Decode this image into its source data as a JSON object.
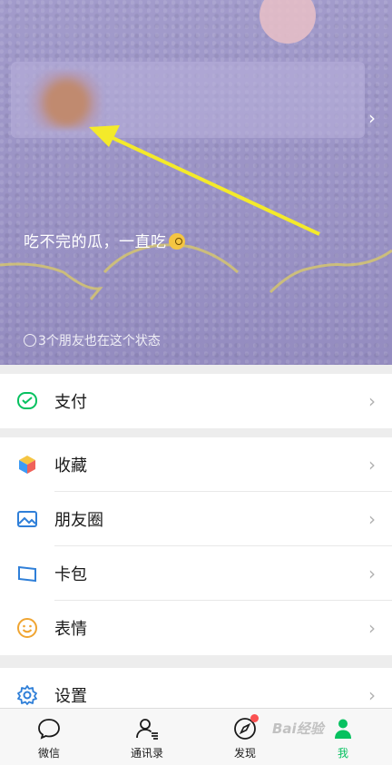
{
  "profile": {
    "status_text": "吃不完的瓜，一直吃",
    "friends_line": "3个朋友也在这个状态"
  },
  "menu": {
    "pay": {
      "label": "支付",
      "icon": "wechat-pay-icon"
    },
    "favorites": {
      "label": "收藏",
      "icon": "cube-icon"
    },
    "moments": {
      "label": "朋友圈",
      "icon": "image-icon"
    },
    "cards": {
      "label": "卡包",
      "icon": "card-wallet-icon"
    },
    "stickers": {
      "label": "表情",
      "icon": "smiley-icon"
    },
    "settings": {
      "label": "设置",
      "icon": "gear-icon"
    }
  },
  "tabs": [
    {
      "label": "微信",
      "icon": "chat-bubble-icon"
    },
    {
      "label": "通讯录",
      "icon": "contacts-icon"
    },
    {
      "label": "发现",
      "icon": "compass-icon",
      "badge": true
    },
    {
      "label": "我",
      "icon": "person-icon",
      "active": true
    }
  ],
  "colors": {
    "accent": "#07c160",
    "banner": "#9b93c6",
    "badge": "#fa5151",
    "annotation_arrow": "#f4ea2a"
  },
  "watermark": "Bai经验"
}
